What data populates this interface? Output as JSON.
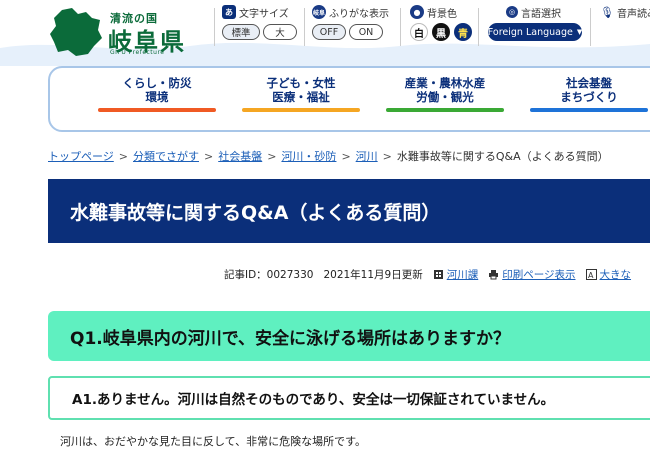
{
  "header": {
    "logo_sub": "清流の国",
    "logo_main": "岐阜県",
    "logo_en": "GIFU Prefecture",
    "font_size": {
      "label": "文字サイズ",
      "icon": "あ",
      "options": [
        "標準",
        "大"
      ]
    },
    "furigana": {
      "label": "ふりがな表示",
      "icon": "岐阜",
      "options": [
        "OFF",
        "ON"
      ]
    },
    "bg_color": {
      "label": "背景色",
      "options": [
        "白",
        "黒",
        "青"
      ]
    },
    "language": {
      "label": "言語選択",
      "button": "Foreign Language"
    },
    "voice": {
      "label": "音声読み"
    }
  },
  "nav": {
    "items": [
      {
        "label1": "くらし・防災",
        "label2": "環境",
        "color": "#f05a24"
      },
      {
        "label1": "子ども・女性",
        "label2": "医療・福祉",
        "color": "#f5a623"
      },
      {
        "label1": "産業・農林水産",
        "label2": "労働・観光",
        "color": "#3aa935"
      },
      {
        "label1": "社会基盤",
        "label2": "まちづくり",
        "color": "#1e73d8"
      }
    ]
  },
  "breadcrumb": {
    "links": [
      "トップページ",
      "分類でさがす",
      "社会基盤",
      "河川・砂防",
      "河川"
    ],
    "current": "水難事故等に関するQ&A（よくある質問）"
  },
  "page_title": "水難事故等に関するQ&A（よくある質問）",
  "meta": {
    "article_id": "記事ID：0027330",
    "date": "2021年11月9日更新",
    "dept": "河川課",
    "print": "印刷ページ表示",
    "large": "大きな"
  },
  "question": "Q1.岐阜県内の河川で、安全に泳げる場所はありますか？",
  "answer": "A1.ありません。河川は自然そのものであり、安全は一切保証されていません。",
  "body_text": "河川は、おだやかな見た目に反して、非常に危険な場所です。",
  "colors": {
    "primary": "#0b2f7a",
    "q_bg": "#5ff0c0",
    "brand_green": "#0b6b3a"
  }
}
